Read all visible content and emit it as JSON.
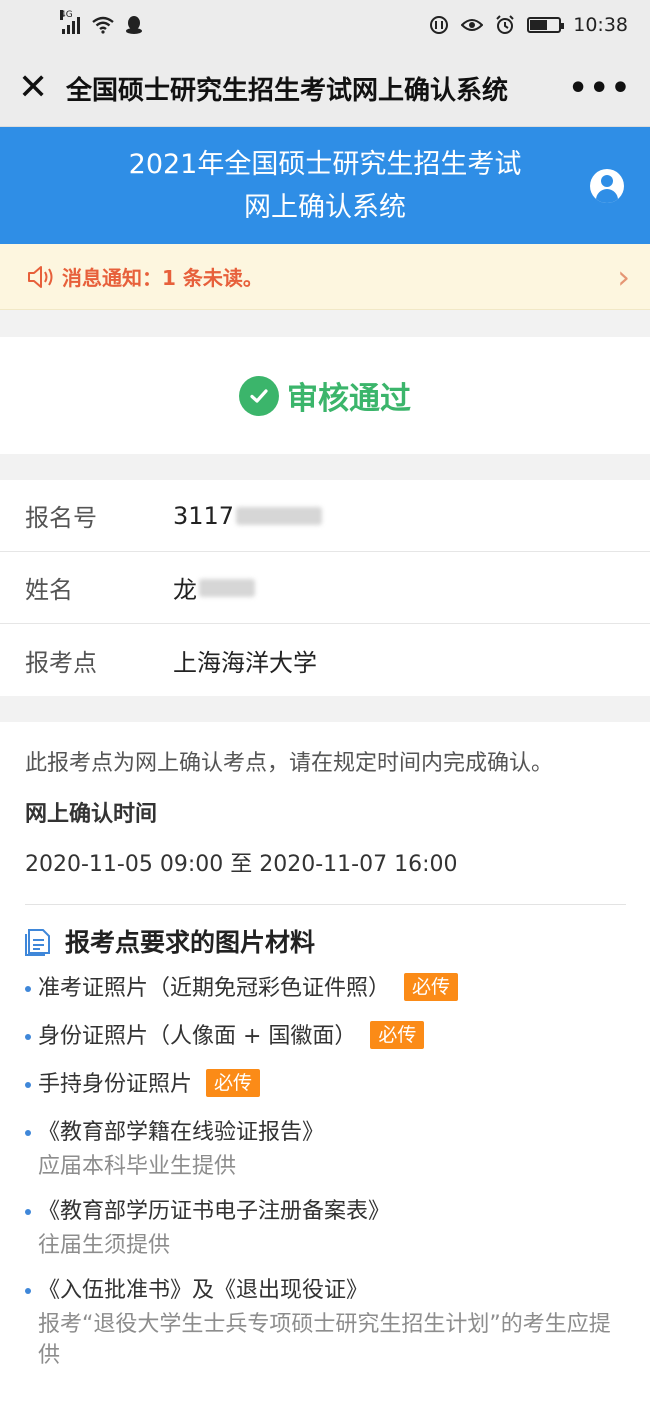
{
  "status_bar": {
    "network": "4G",
    "time": "10:38"
  },
  "nav": {
    "close_icon": "close-icon",
    "title": "全国硕士研究生招生考试网上确认系统",
    "more_icon": "more-icon"
  },
  "banner": {
    "line1": "2021年全国硕士研究生招生考试",
    "line2": "网上确认系统",
    "user_icon": "user-icon",
    "color": "#2f8ee6"
  },
  "notice": {
    "icon": "speaker-icon",
    "text": "消息通知：1 条未读。"
  },
  "review": {
    "icon": "check-circle-icon",
    "text": "审核通过",
    "color": "#3bb56b"
  },
  "info": [
    {
      "label": "报名号",
      "value": "3117"
    },
    {
      "label": "姓名",
      "value": "龙"
    },
    {
      "label": "报考点",
      "value": "上海海洋大学"
    }
  ],
  "confirm": {
    "description": "此报考点为网上确认考点，请在规定时间内完成确认。",
    "time_heading": "网上确认时间",
    "time_range": "2020-11-05 09:00 至 2020-11-07 16:00"
  },
  "materials": {
    "icon": "document-icon",
    "title": "报考点要求的图片材料",
    "required_label": "必传",
    "badge_color": "#fb8b17",
    "items": [
      {
        "text": "准考证照片（近期免冠彩色证件照）",
        "note": ""
      },
      {
        "text": "身份证照片（人像面 + 国徽面）",
        "note": ""
      },
      {
        "text": "手持身份证照片",
        "note": ""
      },
      {
        "text": "《教育部学籍在线验证报告》",
        "note": "应届本科毕业生提供"
      },
      {
        "text": "《教育部学历证书电子注册备案表》",
        "note": "往届生须提供"
      },
      {
        "text": "《入伍批准书》及《退出现役证》",
        "note": "报考“退役大学生士兵专项硕士研究生招生计划”的考生应提供"
      }
    ]
  }
}
